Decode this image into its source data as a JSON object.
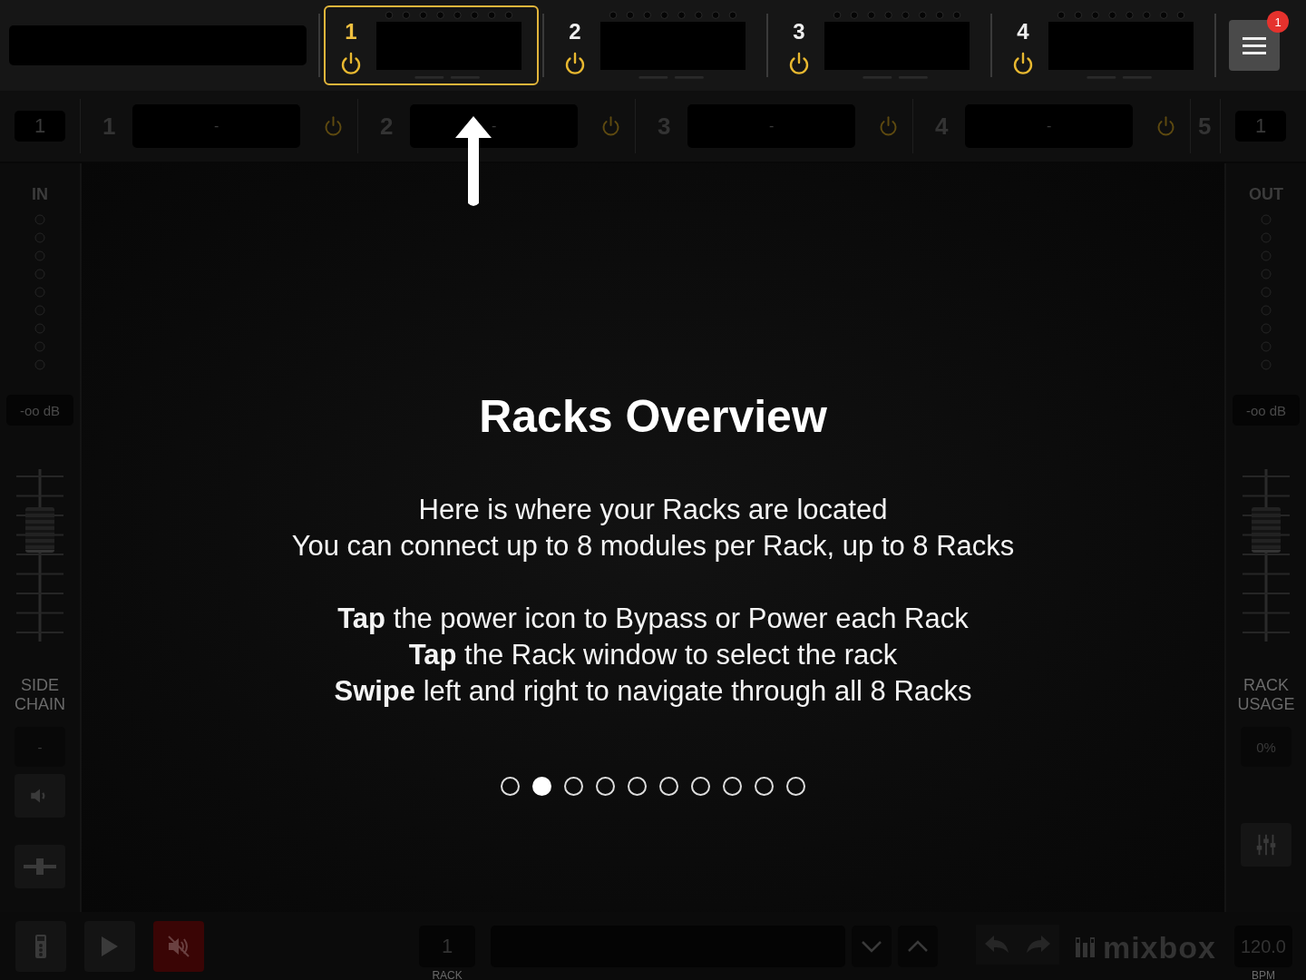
{
  "top_bar": {
    "racks": [
      {
        "number": "1",
        "selected": true
      },
      {
        "number": "2",
        "selected": false
      },
      {
        "number": "3",
        "selected": false
      },
      {
        "number": "4",
        "selected": false
      }
    ],
    "menu": {
      "badge": "1"
    }
  },
  "slot_row": {
    "left_value": "1",
    "slots": [
      {
        "number": "1",
        "value": "-"
      },
      {
        "number": "2",
        "value": "-"
      },
      {
        "number": "3",
        "value": "-"
      },
      {
        "number": "4",
        "value": "-"
      }
    ],
    "next_slot_number": "5",
    "right_value": "1"
  },
  "left_panel": {
    "label": "IN",
    "readout": "-oo dB",
    "fader": {
      "level": 0.7
    },
    "section_label": "SIDE CHAIN",
    "section_value": "-"
  },
  "right_panel": {
    "label": "OUT",
    "readout": "-oo dB",
    "fader": {
      "level": 0.7
    },
    "section_label": "RACK USAGE",
    "section_value": "0%"
  },
  "overlay": {
    "title": "Racks Overview",
    "paragraphs": [
      [
        "Here is where your Racks are located",
        "You can connect up to 8 modules per Rack, up to 8 Racks"
      ],
      [
        "**Tap** the power icon to Bypass or Power each Rack",
        "**Tap** the Rack window to select the rack",
        "**Swipe** left and right to navigate through all 8 Racks"
      ]
    ],
    "pages": [
      {
        "selected": false
      },
      {
        "selected": true
      },
      {
        "selected": false
      },
      {
        "selected": false
      },
      {
        "selected": false
      },
      {
        "selected": false
      },
      {
        "selected": false
      },
      {
        "selected": false
      },
      {
        "selected": false
      },
      {
        "selected": false
      }
    ]
  },
  "bottom_bar": {
    "muted": true,
    "rack_value": "1",
    "rack_label": "RACK",
    "logo": "mixbox",
    "bpm_value": "120.0",
    "bpm_label": "BPM"
  }
}
